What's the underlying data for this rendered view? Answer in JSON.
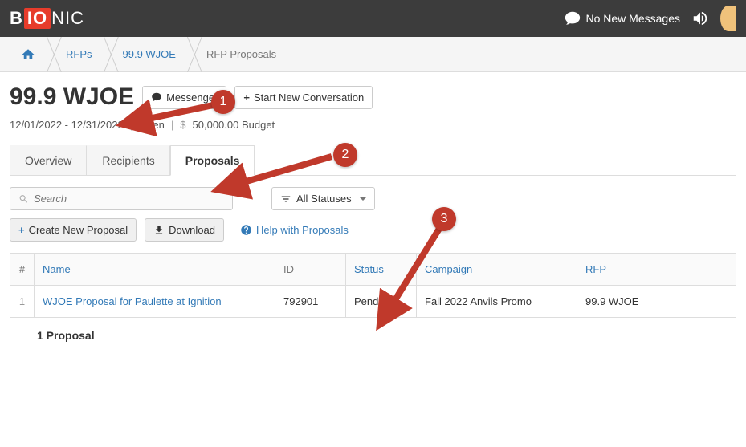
{
  "topbar": {
    "logo_parts": {
      "pre": "B",
      "mid": "IO",
      "post": "NIC"
    },
    "messages_label": "No New Messages"
  },
  "breadcrumbs": {
    "rfps": "RFPs",
    "station": "99.9 WJOE",
    "current": "RFP Proposals"
  },
  "header": {
    "title": "99.9 WJOE",
    "messenger_btn": "Messenger",
    "new_conv_btn": "Start New Conversation",
    "date_range": "12/01/2022 - 12/31/2022",
    "status": "Open",
    "budget": "50,000.00 Budget"
  },
  "tabs": {
    "overview": "Overview",
    "recipients": "Recipients",
    "proposals": "Proposals"
  },
  "toolbar": {
    "search_placeholder": "Search",
    "status_filter": "All Statuses",
    "create_btn": "Create New Proposal",
    "download_btn": "Download",
    "help_link": "Help with Proposals"
  },
  "table": {
    "headers": {
      "num": "#",
      "name": "Name",
      "id": "ID",
      "status": "Status",
      "campaign": "Campaign",
      "rfp": "RFP"
    },
    "rows": [
      {
        "num": "1",
        "name": "WJOE Proposal for Paulette at Ignition",
        "id": "792901",
        "status": "Pending",
        "campaign": "Fall 2022 Anvils Promo",
        "rfp": "99.9 WJOE"
      }
    ],
    "count_label": "1 Proposal"
  },
  "annotations": {
    "a1": "1",
    "a2": "2",
    "a3": "3"
  }
}
